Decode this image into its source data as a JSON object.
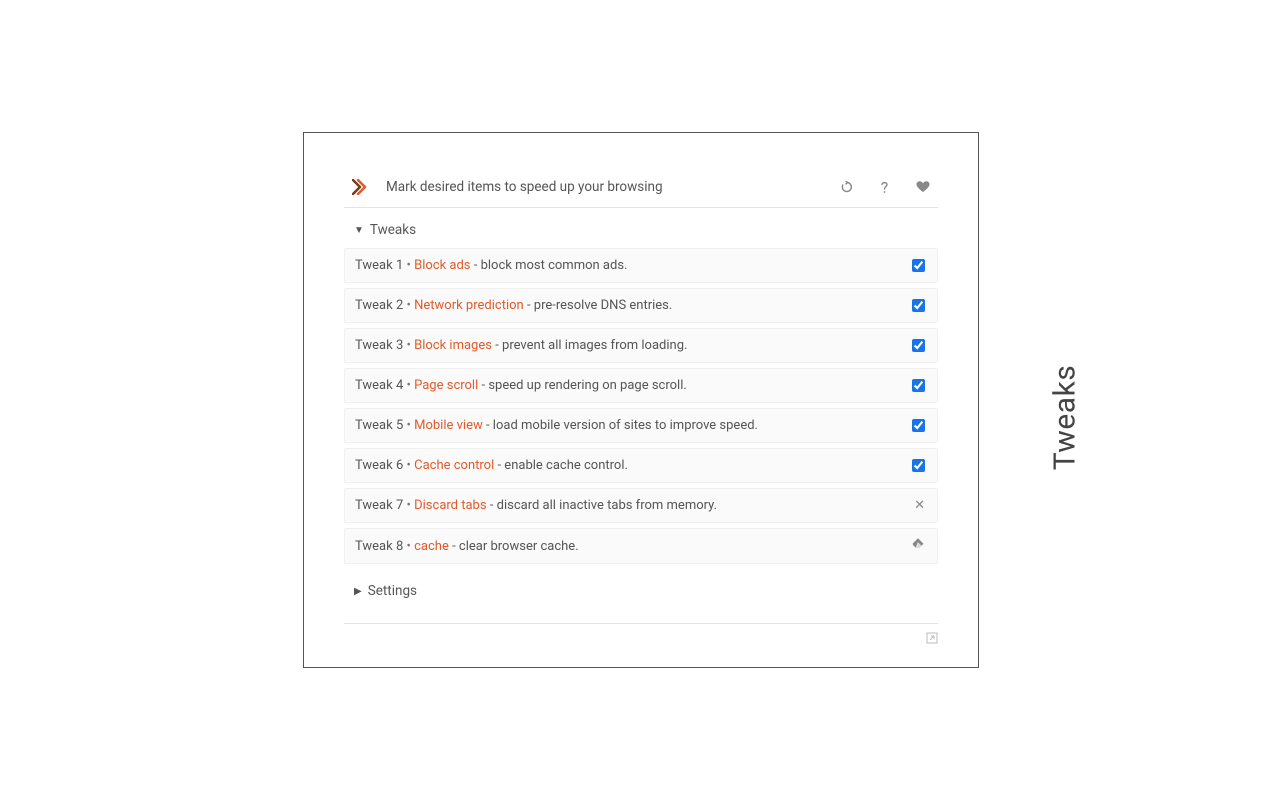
{
  "sideLabel": "Tweaks",
  "header": {
    "text": "Mark desired items to speed up your browsing"
  },
  "sections": {
    "tweaks": {
      "label": "Tweaks",
      "expanded": true
    },
    "settings": {
      "label": "Settings",
      "expanded": false
    }
  },
  "tweaks": [
    {
      "prefix": "Tweak 1",
      "name": "Block ads",
      "desc": "block most common ads.",
      "control": "checkbox",
      "checked": true
    },
    {
      "prefix": "Tweak 2",
      "name": "Network prediction",
      "desc": "pre-resolve DNS entries.",
      "control": "checkbox",
      "checked": true
    },
    {
      "prefix": "Tweak 3",
      "name": "Block images",
      "desc": "prevent all images from loading.",
      "control": "checkbox",
      "checked": true
    },
    {
      "prefix": "Tweak 4",
      "name": "Page scroll",
      "desc": "speed up rendering on page scroll.",
      "control": "checkbox",
      "checked": true
    },
    {
      "prefix": "Tweak 5",
      "name": "Mobile view",
      "desc": "load mobile version of sites to improve speed.",
      "control": "checkbox",
      "checked": true
    },
    {
      "prefix": "Tweak 6",
      "name": "Cache control",
      "desc": "enable cache control.",
      "control": "checkbox",
      "checked": true
    },
    {
      "prefix": "Tweak 7",
      "name": "Discard tabs",
      "desc": "discard all inactive tabs from memory.",
      "control": "close"
    },
    {
      "prefix": "Tweak 8",
      "name": "cache",
      "desc": "clear browser cache.",
      "control": "eraser"
    }
  ]
}
